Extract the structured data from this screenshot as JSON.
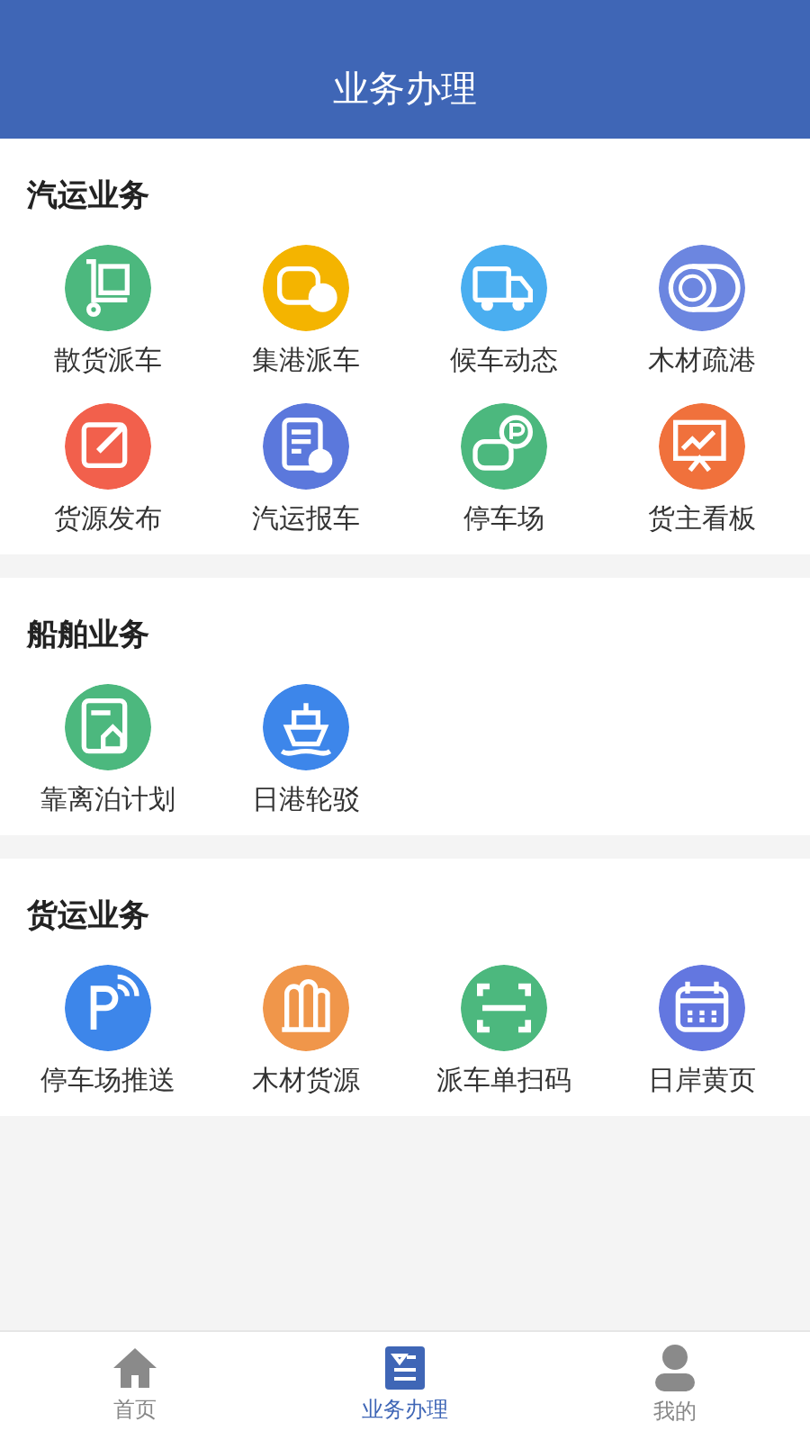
{
  "header": {
    "title": "业务办理"
  },
  "sections": [
    {
      "title": "汽运业务",
      "items": [
        {
          "label": "散货派车",
          "kind": "cart",
          "color": "#4cb87e"
        },
        {
          "label": "集港派车",
          "kind": "car-badge",
          "color": "#f4b400"
        },
        {
          "label": "候车动态",
          "kind": "truck",
          "color": "#4aaef0"
        },
        {
          "label": "木材疏港",
          "kind": "log",
          "color": "#6c86e0"
        },
        {
          "label": "货源发布",
          "kind": "edit",
          "color": "#f2604c"
        },
        {
          "label": "汽运报车",
          "kind": "doc-check",
          "color": "#5b78dc"
        },
        {
          "label": "停车场",
          "kind": "car-parking",
          "color": "#4cb87e"
        },
        {
          "label": "货主看板",
          "kind": "board",
          "color": "#f0713c"
        }
      ]
    },
    {
      "title": "船舶业务",
      "items": [
        {
          "label": "靠离泊计划",
          "kind": "doc-ship",
          "color": "#4cb87e"
        },
        {
          "label": "日港轮驳",
          "kind": "ship",
          "color": "#3d86ea"
        }
      ]
    },
    {
      "title": "货运业务",
      "items": [
        {
          "label": "停车场推送",
          "kind": "p-signal",
          "color": "#3d86ea"
        },
        {
          "label": "木材货源",
          "kind": "logs",
          "color": "#f0964a"
        },
        {
          "label": "派车单扫码",
          "kind": "scan",
          "color": "#4cb87e"
        },
        {
          "label": "日岸黄页",
          "kind": "calendar",
          "color": "#6377e0"
        }
      ]
    }
  ],
  "tabs": [
    {
      "label": "首页",
      "kind": "home",
      "selected": false
    },
    {
      "label": "业务办理",
      "kind": "work",
      "selected": true
    },
    {
      "label": "我的",
      "kind": "user",
      "selected": false
    }
  ]
}
